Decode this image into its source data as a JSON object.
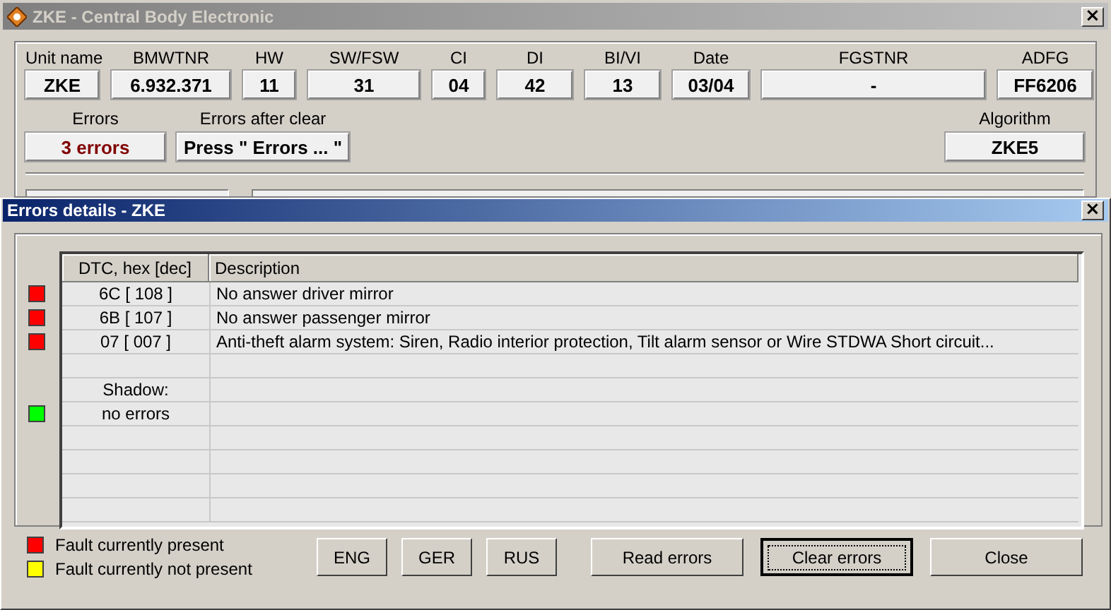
{
  "main_window": {
    "title": "ZKE - Central Body Electronic",
    "close": "×",
    "fields": [
      {
        "label": "Unit name",
        "value": "ZKE"
      },
      {
        "label": "BMWTNR",
        "value": "6.932.371"
      },
      {
        "label": "HW",
        "value": "11"
      },
      {
        "label": "SW/FSW",
        "value": "31"
      },
      {
        "label": "CI",
        "value": "04"
      },
      {
        "label": "DI",
        "value": "42"
      },
      {
        "label": "BI/VI",
        "value": "13"
      },
      {
        "label": "Date",
        "value": "03/04"
      },
      {
        "label": "FGSTNR",
        "value": "-"
      },
      {
        "label": "ADFG",
        "value": "FF6206"
      }
    ],
    "status_fields": [
      {
        "label": "Errors",
        "value": "3 errors",
        "kind": "alert"
      },
      {
        "label": "Errors after clear",
        "value": "Press \" Errors ... \"",
        "kind": "normal"
      },
      {
        "label": "Algorithm",
        "value": "ZKE5",
        "kind": "normal"
      }
    ]
  },
  "details_window": {
    "title": "Errors details - ZKE",
    "close": "×",
    "table": {
      "columns": [
        "DTC, hex [dec]",
        "Description"
      ],
      "rows": [
        {
          "kind": "error",
          "color": "#ff0000",
          "dtc": "6C [ 108 ]",
          "description": "No answer driver mirror"
        },
        {
          "kind": "error",
          "color": "#ff0000",
          "dtc": "6B [ 107 ]",
          "description": "No answer passenger mirror"
        },
        {
          "kind": "error",
          "color": "#ff0000",
          "dtc": "07 [ 007 ]",
          "description": "Anti-theft alarm system: Siren, Radio interior protection, Tilt alarm sensor or Wire STDWA Short circuit..."
        },
        {
          "kind": "blank"
        },
        {
          "kind": "label",
          "dtc": "Shadow:"
        },
        {
          "kind": "error",
          "color": "#00ff00",
          "dtc": "no errors"
        },
        {
          "kind": "blank"
        },
        {
          "kind": "blank"
        },
        {
          "kind": "blank"
        },
        {
          "kind": "blank"
        }
      ]
    },
    "legend": [
      {
        "color": "#ff0000",
        "label": "Fault currently present"
      },
      {
        "color": "#ffff00",
        "label": "Fault currently not present"
      }
    ],
    "buttons": [
      {
        "label": "ENG",
        "kind": "small",
        "focused": false
      },
      {
        "label": "GER",
        "kind": "small",
        "focused": false
      },
      {
        "label": "RUS",
        "kind": "small",
        "focused": false
      },
      {
        "label": "Read errors",
        "kind": "wide",
        "focused": false
      },
      {
        "label": "Clear errors",
        "kind": "wide",
        "focused": true
      },
      {
        "label": "Close",
        "kind": "wide",
        "focused": false
      }
    ]
  }
}
